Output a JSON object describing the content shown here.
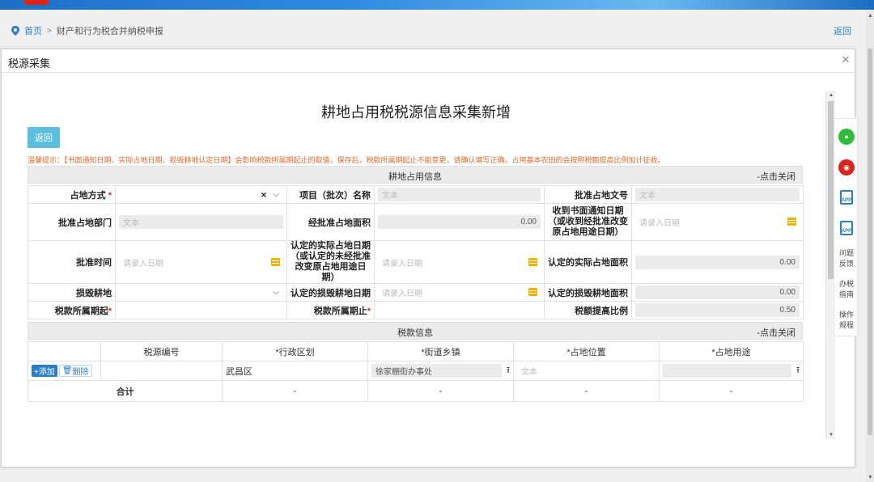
{
  "breadcrumb": {
    "home": "首页",
    "separator": ">",
    "current": "财产和行为税合并纳税申报",
    "back": "返回"
  },
  "modal": {
    "title": "税源采集",
    "close": "×",
    "form_title": "耕地占用税税源信息采集新增",
    "back_button": "返回",
    "tip": "温馨提示：【书面通知日期、实际占地日期、损毁耕地认定日期】会影响税款所属期起止的取值，保存后，税款所属期起止不能变更，请确认填写正确。占用基本农田的会按照税额提高比例加计征收。"
  },
  "section_occupy": {
    "title": "耕地占用信息",
    "close": "-点击关闭",
    "row1": {
      "occupy_method_label": "占地方式",
      "occupy_method_required": "*",
      "project_name_label": "项目（批次）名称",
      "project_name_placeholder": "文本",
      "approval_doc_label": "批准占地文号",
      "approval_doc_placeholder": "文本"
    },
    "row2": {
      "approval_dept_label": "批准占地部门",
      "approval_dept_placeholder": "文本",
      "approved_area_label": "经批准占地面积",
      "approved_area_value": "0.00",
      "notice_date_label": "收到书面通知日期（或收到经批准改变原占地用途日期）",
      "notice_date_placeholder": "请录入日期"
    },
    "row3": {
      "approval_time_label": "批准时间",
      "approval_time_placeholder": "请录入日期",
      "actual_date_label": "认定的实际占地日期（或认定的未经批准改变原占地用途日期）",
      "actual_date_placeholder": "请录入日期",
      "actual_area_label": "认定的实际占地面积",
      "actual_area_value": "0.00"
    },
    "row4": {
      "damaged_label": "损毁耕地",
      "damaged_date_label": "认定的损毁耕地日期",
      "damaged_date_placeholder": "请录入日期",
      "damaged_area_label": "认定的损毁耕地面积",
      "damaged_area_value": "0.00"
    },
    "row5": {
      "period_start_label": "税款所属期起",
      "period_start_required": "*",
      "period_end_label": "税款所属期止",
      "period_end_required": "*",
      "rate_label": "税额提高比例",
      "rate_value": "0.50"
    }
  },
  "section_tax": {
    "title": "税款信息",
    "close": "-点击关闭",
    "columns": [
      "税源编号",
      "*行政区划",
      "*街道乡镇",
      "*占地位置",
      "*占地用途"
    ],
    "add_button": "+添加",
    "delete_button": "删除",
    "row": {
      "district": "武昌区",
      "street": "徐家棚街办事处",
      "location_placeholder": "文本"
    },
    "total_row": {
      "label": "合计",
      "dashes": [
        "-",
        "-",
        "-",
        "-"
      ]
    }
  },
  "side_panel": {
    "feedback": "问题反馈",
    "guide": "办税指南",
    "rules": "操作规程",
    "app_label": "APP"
  }
}
